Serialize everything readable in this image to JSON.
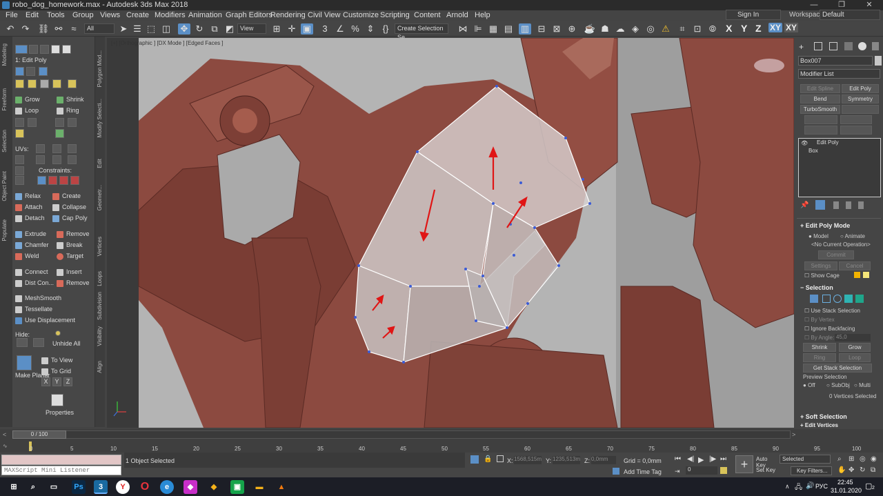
{
  "window": {
    "title": "robo_dog_homework.max - Autodesk 3ds Max 2018",
    "minimize": "—",
    "restore": "❐",
    "close": "✕"
  },
  "menu": [
    "File",
    "Edit",
    "Tools",
    "Group",
    "Views",
    "Create",
    "Modifiers",
    "Animation",
    "Graph Editors",
    "Rendering",
    "Civil View",
    "Customize",
    "Scripting",
    "Content",
    "Arnold",
    "Help"
  ],
  "account": {
    "signin": "Sign In",
    "workspaces_label": "Workspaces:",
    "workspace": "Default"
  },
  "toolbar": {
    "filter": "All",
    "refcoord": "View",
    "selection_set": "Create Selection Se",
    "axes": [
      "X",
      "Y",
      "Z",
      "XY",
      "XY"
    ]
  },
  "ribbon": {
    "tabs": [
      "Modeling",
      "Freeform",
      "Selection",
      "Object Paint",
      "Populate"
    ],
    "side_tabs": [
      "Polygon Mod...",
      "Modify Selecti...",
      "Edit",
      "Geometr...",
      "Vertices",
      "Loops",
      "Subdivision",
      "Visibility",
      "Align"
    ],
    "modifier_label": "1: Edit Poly",
    "grow": "Grow",
    "shrink": "Shrink",
    "loop": "Loop",
    "ring": "Ring",
    "uvs": "UVs:",
    "constraints": "Constraints:",
    "relax": "Relax",
    "create": "Create",
    "attach": "Attach",
    "collapse": "Collapse",
    "detach": "Detach",
    "cap_poly": "Cap Poly",
    "extrude": "Extrude",
    "remove": "Remove",
    "chamfer": "Chamfer",
    "break": "Break",
    "weld": "Weld",
    "target": "Target",
    "connect": "Connect",
    "insert": "Insert",
    "dist_con": "Dist Con...",
    "remove2": "Remove",
    "meshsmooth": "MeshSmooth",
    "tessellate": "Tessellate",
    "use_displacement": "Use Displacement",
    "hide": "Hide:",
    "unhide_all": "Unhide All",
    "to_view": "To View",
    "to_grid": "To Grid",
    "make_planar": "Make Planar",
    "planar_axes": [
      "X",
      "Y",
      "Z"
    ],
    "properties": "Properties"
  },
  "viewport": {
    "label": "[+] [Orthographic ] [DX Mode ] [Edged Faces ]"
  },
  "cmdpanel": {
    "object_name": "Box007",
    "modifier_list": "Modifier List",
    "buttons": [
      "Edit Spline",
      "Edit Poly",
      "Bend",
      "Symmetry",
      "TurboSmooth"
    ],
    "stack": [
      "Edit Poly",
      "Box"
    ],
    "edit_poly_mode": "Edit Poly Mode",
    "model": "Model",
    "animate": "Animate",
    "no_op": "<No Current Operation>",
    "commit": "Commit",
    "settings": "Settings",
    "cancel": "Cancel",
    "show_cage": "Show Cage",
    "selection": "Selection",
    "use_stack": "Use Stack Selection",
    "by_vertex": "By Vertex",
    "ignore_backfacing": "Ignore Backfacing",
    "by_angle": "By Angle:",
    "angle_value": "45,0",
    "shrink": "Shrink",
    "grow": "Grow",
    "ring": "Ring",
    "loop": "Loop",
    "get_stack": "Get Stack Selection",
    "preview": "Preview Selection",
    "off": "Off",
    "subobj": "SubObj",
    "multi": "Multi",
    "vertices_selected": "0 Vertices Selected",
    "soft_selection": "Soft Selection",
    "edit_vertices": "Edit Vertices"
  },
  "timeline": {
    "frame": "0 / 100",
    "ticks": [
      "0",
      "5",
      "10",
      "15",
      "20",
      "25",
      "30",
      "35",
      "40",
      "45",
      "50",
      "55",
      "60",
      "65",
      "70",
      "75",
      "80",
      "85",
      "90",
      "95",
      "100"
    ]
  },
  "status": {
    "selected": "1 Object Selected",
    "maxscript": "MAXScript Mini Listener",
    "x_label": "X:",
    "x": "1568,515m",
    "y_label": "Y:",
    "y": "1235,513m",
    "z_label": "Z:",
    "z": "0,0mm",
    "grid": "Grid = 0,0mm",
    "add_time_tag": "Add Time Tag",
    "auto_key": "Auto Key",
    "set_key": "Set Key",
    "key_mode": "Selected",
    "key_filters": "Key Filters...",
    "frame_field": "0"
  },
  "taskbar": {
    "lang": "РУС",
    "time": "22:45",
    "date": "31.01.2020",
    "notif": "2"
  }
}
